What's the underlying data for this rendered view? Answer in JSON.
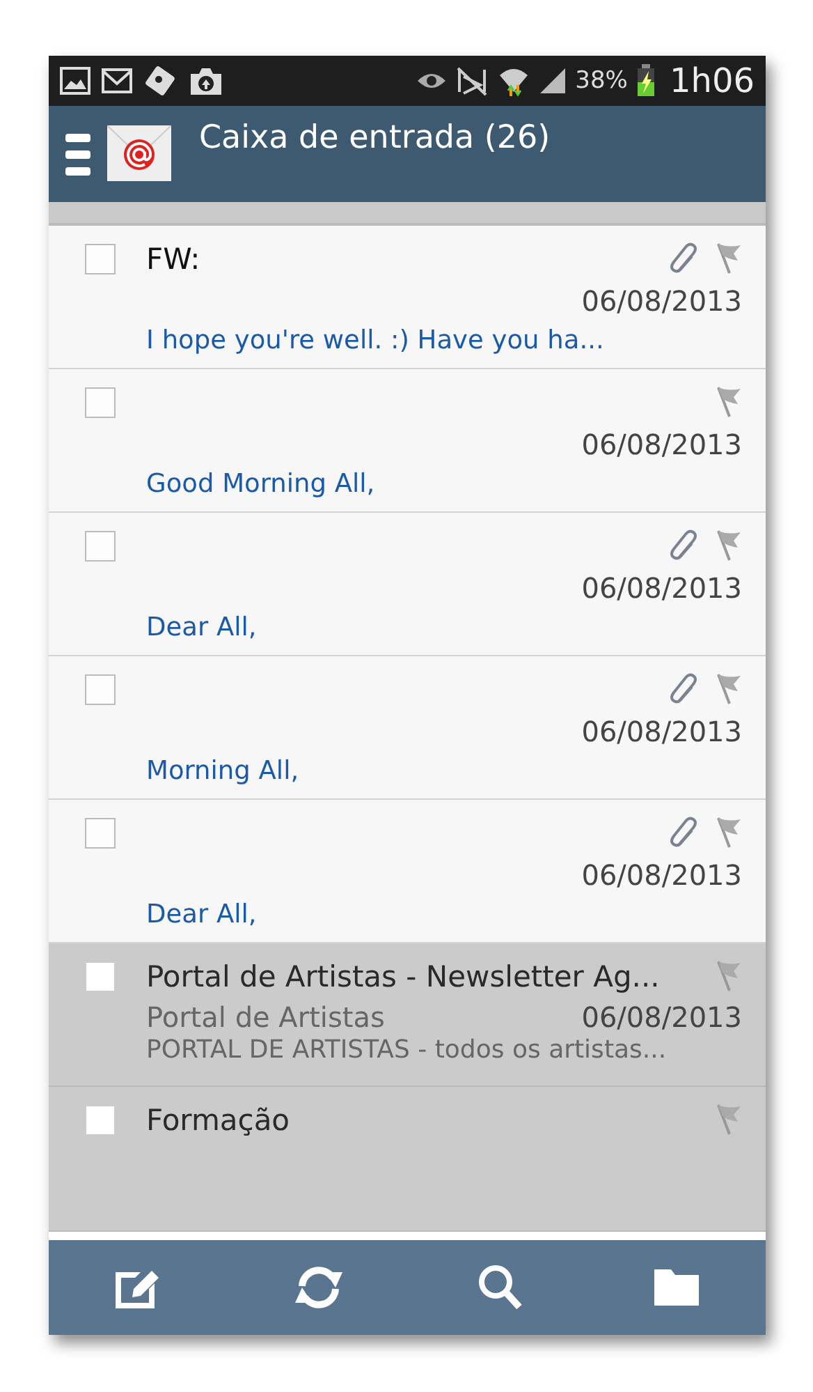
{
  "status_bar": {
    "battery_text": "38%",
    "time": "1h06"
  },
  "header": {
    "title": "Caixa de entrada (26)"
  },
  "messages": [
    {
      "subject": "FW:",
      "date": "06/08/2013",
      "preview": "I hope you're well. :) Have you ha...",
      "read": false,
      "attachment": true,
      "checked": false
    },
    {
      "date": "06/08/2013",
      "preview": "Good Morning All,",
      "read": false,
      "attachment": false,
      "checked": false
    },
    {
      "date": "06/08/2013",
      "preview": "Dear All,",
      "read": false,
      "attachment": true,
      "checked": false
    },
    {
      "date": "06/08/2013",
      "preview": "Morning All,",
      "read": false,
      "attachment": true,
      "checked": false
    },
    {
      "date": "06/08/2013",
      "preview": "Dear All,",
      "read": false,
      "attachment": true,
      "checked": false
    },
    {
      "subject": "Portal de Artistas - Newsletter Ag...",
      "sender": "Portal de Artistas",
      "date": "06/08/2013",
      "preview": "PORTAL DE ARTISTAS - todos os artistas...",
      "read": true,
      "attachment": false,
      "checked": false
    },
    {
      "subject": "Formação",
      "read": true,
      "attachment": false,
      "checked": false
    }
  ]
}
